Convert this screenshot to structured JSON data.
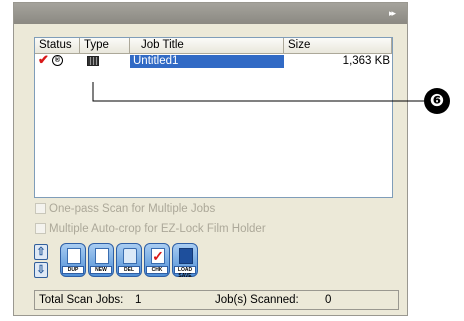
{
  "list": {
    "columns": [
      "Status",
      "Type",
      "Job Title",
      "Size"
    ],
    "rows": [
      {
        "status_check": "✔",
        "status_lock": "®",
        "title": "Untitled1",
        "size": "1,363 KB"
      }
    ]
  },
  "options": {
    "one_pass": "One-pass Scan for Multiple Jobs",
    "auto_crop": "Multiple Auto-crop for EZ-Lock Film Holder"
  },
  "toolbar": {
    "up_icon": "⇧",
    "down_icon": "⇩",
    "buttons": [
      "DUP",
      "NEW",
      "DEL",
      "CHK",
      "LOAD SAVE"
    ]
  },
  "status": {
    "total_label": "Total Scan Jobs:",
    "total_value": "1",
    "scanned_label": "Job(s) Scanned:",
    "scanned_value": "0"
  },
  "callout": {
    "number": "❻"
  },
  "colors": {
    "selection": "#316ac5",
    "check": "#d81818",
    "panel": "#ece9d8"
  }
}
